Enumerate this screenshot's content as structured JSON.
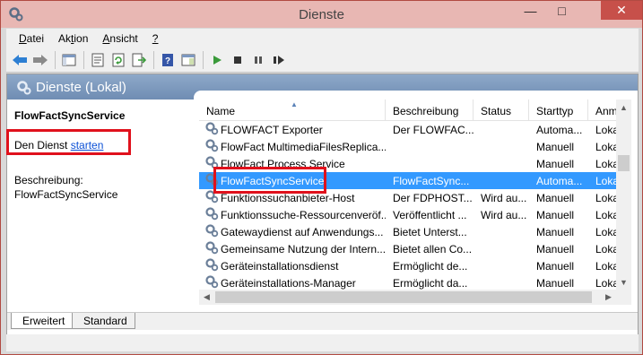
{
  "window": {
    "title": "Dienste"
  },
  "menu": [
    {
      "prefix": "",
      "key": "D",
      "rest": "atei"
    },
    {
      "prefix": "Ak",
      "key": "t",
      "rest": "ion"
    },
    {
      "prefix": "",
      "key": "A",
      "rest": "nsicht"
    },
    {
      "prefix": "",
      "key": "?",
      "rest": ""
    }
  ],
  "toolbar": {
    "icons": [
      "back-arrow-icon",
      "forward-arrow-icon",
      "console-tree-icon",
      "properties-icon",
      "refresh-icon",
      "export-list-icon",
      "help-icon",
      "view-icon",
      "play-icon",
      "stop-icon",
      "pause-icon",
      "restart-icon"
    ]
  },
  "pane": {
    "header_title": "Dienste (Lokal)"
  },
  "left": {
    "service_title": "FlowFactSyncService",
    "start_prefix": "Den Dienst",
    "start_link": "starten",
    "desc_label": "Beschreibung:",
    "desc_value": "FlowFactSyncService"
  },
  "table": {
    "columns": [
      "Name",
      "Beschreibung",
      "Status",
      "Starttyp",
      "Anme"
    ],
    "rows": [
      {
        "name": "FLOWFACT Exporter",
        "desc": "Der FLOWFAC...",
        "status": "",
        "start": "Automa...",
        "anm": "Lokal",
        "selected": false
      },
      {
        "name": "FlowFact MultimediaFilesReplica...",
        "desc": "",
        "status": "",
        "start": "Manuell",
        "anm": "Lokal",
        "selected": false
      },
      {
        "name": "FlowFact Process Service",
        "desc": "",
        "status": "",
        "start": "Manuell",
        "anm": "Lokal",
        "selected": false
      },
      {
        "name": "FlowFactSyncService",
        "desc": "FlowFactSync...",
        "status": "",
        "start": "Automa...",
        "anm": "Lokal",
        "selected": true
      },
      {
        "name": "Funktionssuchanbieter-Host",
        "desc": "Der FDPHOST...",
        "status": "Wird au...",
        "start": "Manuell",
        "anm": "Lokal",
        "selected": false
      },
      {
        "name": "Funktionssuche-Ressourcenveröf...",
        "desc": "Veröffentlicht ...",
        "status": "Wird au...",
        "start": "Manuell",
        "anm": "Lokal",
        "selected": false
      },
      {
        "name": "Gatewaydienst auf Anwendungs...",
        "desc": "Bietet Unterst...",
        "status": "",
        "start": "Manuell",
        "anm": "Lokal",
        "selected": false
      },
      {
        "name": "Gemeinsame Nutzung der Intern...",
        "desc": "Bietet allen Co...",
        "status": "",
        "start": "Manuell",
        "anm": "Lokal",
        "selected": false
      },
      {
        "name": "Geräteinstallationsdienst",
        "desc": "Ermöglicht de...",
        "status": "",
        "start": "Manuell",
        "anm": "Lokal",
        "selected": false
      },
      {
        "name": "Geräteinstallations-Manager",
        "desc": "Ermöglicht da...",
        "status": "",
        "start": "Manuell",
        "anm": "Lokal",
        "selected": false
      }
    ]
  },
  "tabs": [
    "Erweitert",
    "Standard"
  ],
  "colors": {
    "selection": "#3399ff",
    "highlight_box": "#e0111c",
    "title_bar": "#e8b7b3"
  }
}
